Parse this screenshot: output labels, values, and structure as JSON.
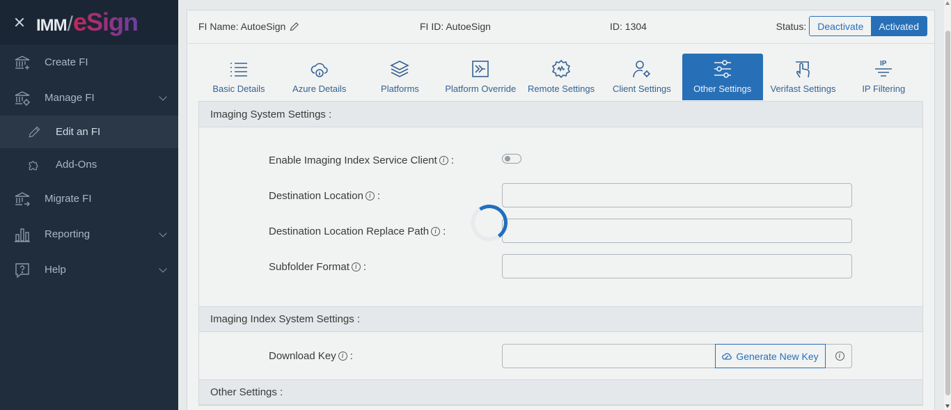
{
  "app": {
    "logo_left": "IMM",
    "logo_right": "eSign"
  },
  "sidebar": {
    "items": [
      {
        "label": "Create FI",
        "icon": "bank-plus-icon"
      },
      {
        "label": "Manage FI",
        "icon": "bank-gear-icon"
      },
      {
        "label": "Edit an FI",
        "icon": "pencil-icon"
      },
      {
        "label": "Add-Ons",
        "icon": "puzzle-icon"
      },
      {
        "label": "Migrate FI",
        "icon": "bank-arrow-icon"
      },
      {
        "label": "Reporting",
        "icon": "bar-chart-icon"
      },
      {
        "label": "Help",
        "icon": "help-bubble-icon"
      }
    ]
  },
  "header": {
    "fi_name": "FI Name: AutoeSign",
    "fi_id": "FI ID: AutoeSign",
    "id": "ID: 1304",
    "status_label": "Status:",
    "deactivate": "Deactivate",
    "activated": "Activated"
  },
  "tabs": [
    {
      "label": "Basic Details",
      "icon": "list-icon"
    },
    {
      "label": "Azure Details",
      "icon": "cloud-info-icon"
    },
    {
      "label": "Platforms",
      "icon": "layers-icon"
    },
    {
      "label": "Platform Override",
      "icon": "arrow-box-icon"
    },
    {
      "label": "Remote Settings",
      "icon": "remote-gear-icon"
    },
    {
      "label": "Client Settings",
      "icon": "user-gear-icon"
    },
    {
      "label": "Other Settings",
      "icon": "sliders-icon",
      "active": true
    },
    {
      "label": "Verifast Settings",
      "icon": "hand-touch-icon"
    },
    {
      "label": "IP Filtering",
      "icon": "ip-filter-icon"
    }
  ],
  "sections": {
    "imaging": {
      "title": "Imaging System Settings :",
      "enable_label": "Enable Imaging Index Service Client",
      "enable_value": "off",
      "dest_label": "Destination Location",
      "dest_value": "",
      "replace_label": "Destination Location Replace Path",
      "replace_value": "",
      "subfolder_label": "Subfolder Format",
      "subfolder_value": ""
    },
    "index": {
      "title": "Imaging Index System Settings :",
      "download_label": "Download Key",
      "download_value": "",
      "generate_label": "Generate New Key"
    },
    "other": {
      "title": "Other Settings :"
    }
  },
  "colors": {
    "primary": "#1f6fbf",
    "sidebar": "#1f2d3d"
  }
}
